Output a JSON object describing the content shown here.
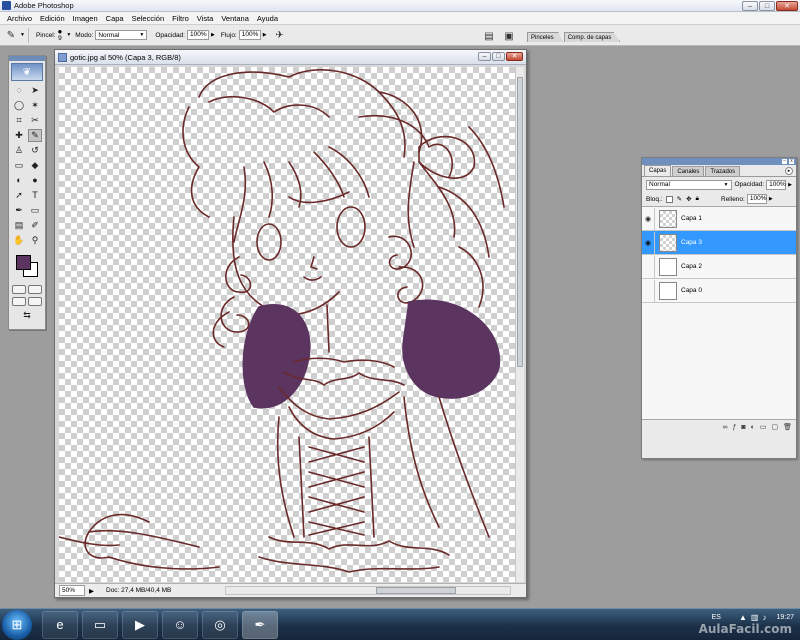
{
  "app": {
    "title": "Adobe Photoshop"
  },
  "menu": [
    "Archivo",
    "Edición",
    "Imagen",
    "Capa",
    "Selección",
    "Filtro",
    "Vista",
    "Ventana",
    "Ayuda"
  ],
  "options": {
    "brush_label": "Pincel:",
    "brush_size": "9",
    "mode_label": "Modo:",
    "mode_value": "Normal",
    "opacity_label": "Opacidad:",
    "opacity_value": "100%",
    "flow_label": "Flujo:",
    "flow_value": "100%"
  },
  "panel_well": {
    "tabs": [
      "Pinceles",
      "Comp. de capas"
    ]
  },
  "document": {
    "title": "gotic.jpg al 50% (Capa 3, RGB/8)",
    "zoom": "50%",
    "doc_info": "Doc: 27,4 MB/40,4 MB"
  },
  "colors": {
    "foreground": "#5b3460",
    "background": "#ffffff",
    "selection": "#3399ff",
    "lineart": "#6b2a2a"
  },
  "layers_panel": {
    "tabs": [
      "Capas",
      "Canales",
      "Trazados"
    ],
    "blend_mode": "Normal",
    "opacity_label": "Opacidad:",
    "opacity_value": "100%",
    "lock_label": "Bloq.:",
    "fill_label": "Relleno:",
    "fill_value": "100%",
    "layers": [
      {
        "name": "Capa 1",
        "visible": true,
        "selected": false
      },
      {
        "name": "Capa 3",
        "visible": true,
        "selected": true
      },
      {
        "name": "Capa 2",
        "visible": false,
        "selected": false
      },
      {
        "name": "Capa 0",
        "visible": false,
        "selected": false
      }
    ]
  },
  "taskbar": {
    "language": "ES",
    "time": "19:27",
    "watermark": "AulaFacil.com"
  }
}
